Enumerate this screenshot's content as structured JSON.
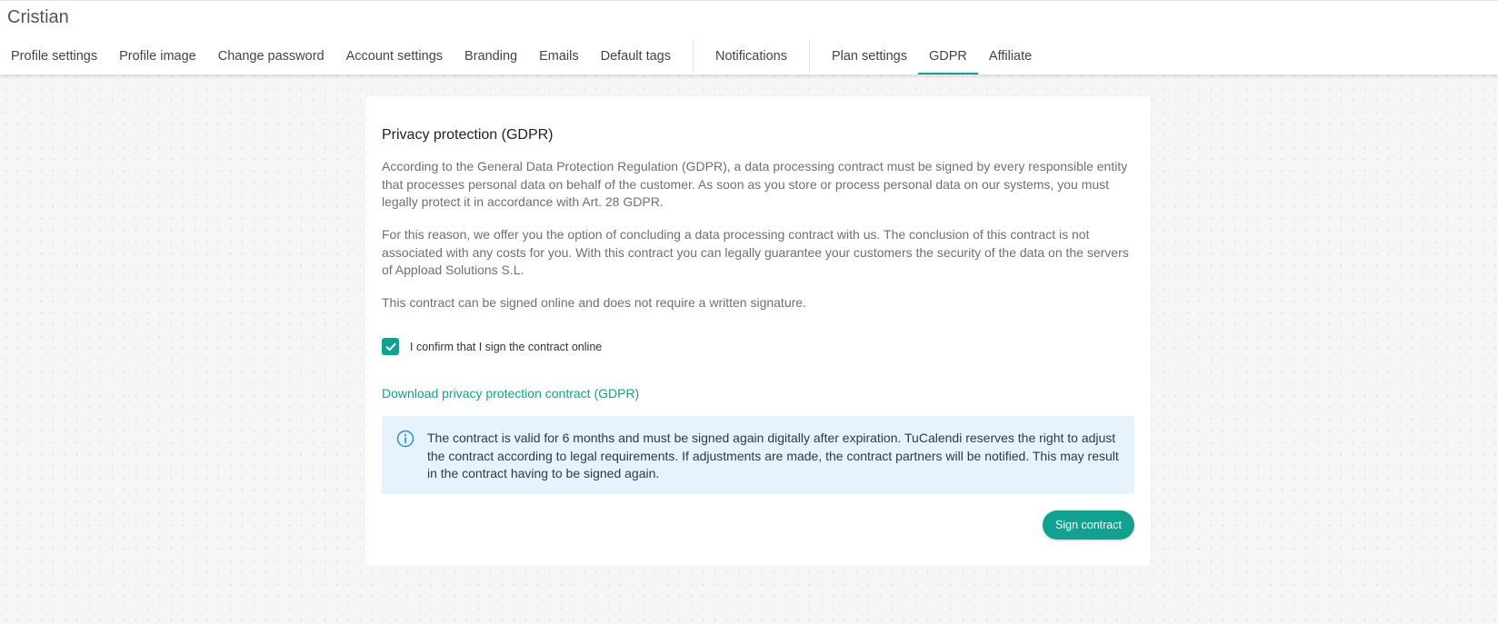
{
  "header": {
    "user_name": "Cristian",
    "tabs": [
      {
        "label": "Profile settings",
        "active": false
      },
      {
        "label": "Profile image",
        "active": false
      },
      {
        "label": "Change password",
        "active": false
      },
      {
        "label": "Account settings",
        "active": false
      },
      {
        "label": "Branding",
        "active": false
      },
      {
        "label": "Emails",
        "active": false
      },
      {
        "label": "Default tags",
        "active": false
      },
      {
        "label": "Notifications",
        "active": false
      },
      {
        "label": "Plan settings",
        "active": false
      },
      {
        "label": "GDPR",
        "active": true
      },
      {
        "label": "Affiliate",
        "active": false
      }
    ]
  },
  "card": {
    "title": "Privacy protection (GDPR)",
    "paragraphs": [
      "According to the General Data Protection Regulation (GDPR), a data processing contract must be signed by every responsible entity that processes personal data on behalf of the customer. As soon as you store or process personal data on our systems, you must legally protect it in accordance with Art. 28 GDPR.",
      "For this reason, we offer you the option of concluding a data processing contract with us. The conclusion of this contract is not associated with any costs for you. With this contract you can legally guarantee your customers the security of the data on the servers of Appload Solutions S.L.",
      "This contract can be signed online and does not require a written signature."
    ],
    "confirm": {
      "label": "I confirm that I sign the contract online",
      "checked": true
    },
    "download_link": "Download privacy protection contract (GDPR)",
    "info": {
      "icon": "info-icon",
      "text": "The contract is valid for 6 months and must be signed again digitally after expiration. TuCalendi reserves the right to adjust the contract according to legal requirements. If adjustments are made, the contract partners will be notified. This may result in the contract having to be signed again."
    },
    "sign_button": "Sign contract"
  },
  "colors": {
    "accent": "#12a08f",
    "info_bg": "#e6f3fc",
    "info_icon": "#2f8fe0"
  }
}
